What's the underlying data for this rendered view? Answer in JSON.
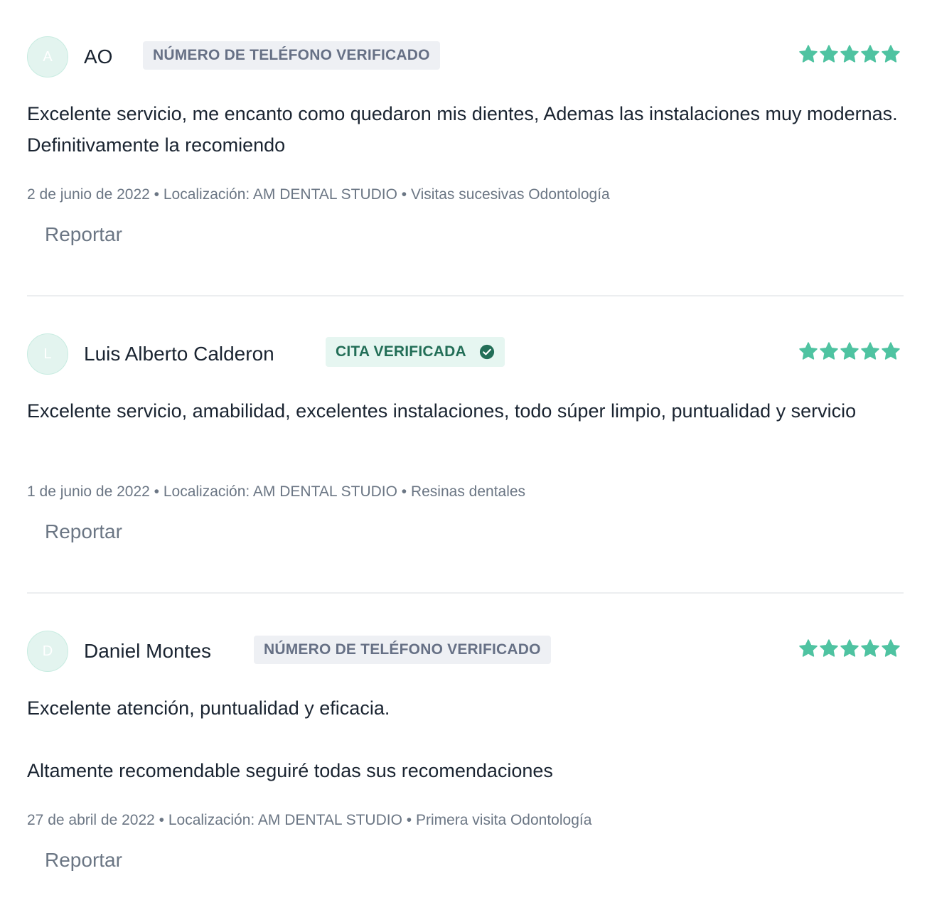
{
  "reviews": [
    {
      "initial": "A",
      "name": "AO",
      "badge": "NÚMERO DE TELÉFONO VERIFICADO",
      "badge_type": "phone",
      "rating": 5,
      "text_1": "Excelente servicio, me encanto como quedaron mis dientes, Ademas las instalaciones muy modernas. Definitivamente la recomiendo",
      "meta": "2 de junio de 2022 • Localización: AM DENTAL STUDIO • Visitas sucesivas Odontología",
      "report": "Reportar"
    },
    {
      "initial": "L",
      "name": "Luis Alberto Calderon",
      "badge": "CITA VERIFICADA",
      "badge_type": "appointment",
      "badge_icon": "check-circle-icon",
      "rating": 5,
      "text_1": "Excelente servicio, amabilidad, excelentes instalaciones, todo súper limpio, puntualidad y servicio",
      "meta": "1 de junio de 2022 • Localización: AM DENTAL STUDIO • Resinas dentales",
      "report": "Reportar"
    },
    {
      "initial": "D",
      "name": "Daniel Montes",
      "badge": "NÚMERO DE TELÉFONO VERIFICADO",
      "badge_type": "phone",
      "rating": 5,
      "text_1": "Excelente atención, puntualidad y eficacia.",
      "text_2": "Altamente recomendable seguiré todas sus recomendaciones",
      "meta": "27 de abril de 2022 • Localización: AM DENTAL STUDIO • Primera visita Odontología",
      "report": "Reportar"
    }
  ],
  "colors": {
    "star": "#4fc3a1",
    "avatar_bg": "#e3f4ef",
    "phone_badge_bg": "#eef0f4",
    "appointment_badge_bg": "#e6f6f1",
    "appointment_badge_text": "#226e57"
  }
}
